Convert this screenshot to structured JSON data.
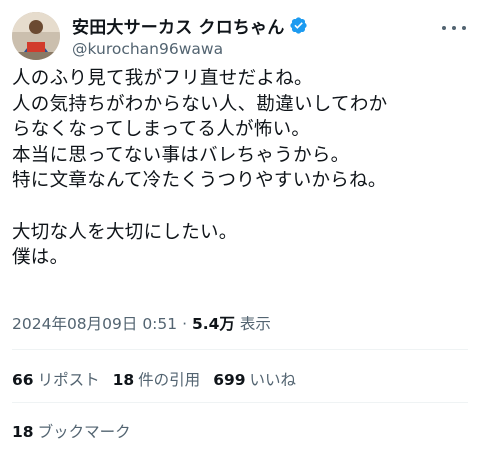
{
  "author": {
    "display_name": "安田大サーカス クロちゃん",
    "handle": "@kurochan96wawa",
    "avatar_icon": "avatar-photo",
    "verified_icon": "verified-badge-icon",
    "verified_color": "#1d9bf0"
  },
  "tweet": {
    "text": "人のふり見て我がフリ直せだよね。\n人の気持ちがわからない人、勘違いしてわか\nらなくなってしまってる人が怖い。\n本当に思ってない事はバレちゃうから。\n特に文章なんて冷たくうつりやすいからね。\n\n大切な人を大切にしたい。\n僕は。"
  },
  "meta": {
    "timestamp": "2024年08月09日 0:51",
    "separator": "·",
    "views_count": "5.4万",
    "views_label": "表示"
  },
  "stats": {
    "reposts": {
      "count": "66",
      "label": "リポスト"
    },
    "quotes": {
      "count": "18",
      "label": "件の引用"
    },
    "likes": {
      "count": "699",
      "label": "いいね"
    },
    "bookmarks": {
      "count": "18",
      "label": "ブックマーク"
    }
  },
  "colors": {
    "text": "#0f1419",
    "secondary": "#536471",
    "divider": "#eff3f4"
  }
}
